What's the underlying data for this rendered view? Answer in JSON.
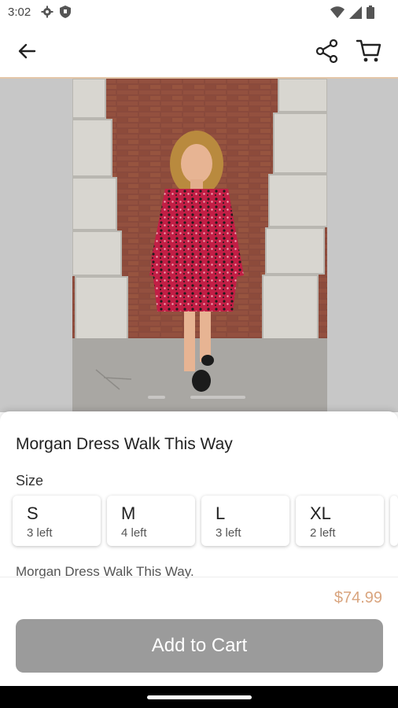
{
  "status_bar": {
    "time": "3:02",
    "left_icons": [
      "gear-icon",
      "shield-icon"
    ],
    "right_icons": [
      "wifi-icon",
      "signal-icon",
      "battery-icon"
    ]
  },
  "app_bar": {
    "icons": [
      "back-arrow-icon",
      "share-icon",
      "cart-icon"
    ]
  },
  "product": {
    "title": "Morgan Dress Walk This Way",
    "size_label": "Size",
    "sizes": [
      {
        "name": "S",
        "stock": "3 left"
      },
      {
        "name": "M",
        "stock": "4 left"
      },
      {
        "name": "L",
        "stock": "3 left"
      },
      {
        "name": "XL",
        "stock": "2 left"
      }
    ],
    "description": "Morgan Dress Walk This Way.",
    "price": "$74.99",
    "add_to_cart_label": "Add to Cart"
  },
  "colors": {
    "accent": "#d9a57f",
    "button_disabled": "#9b9b9b",
    "app_bar_border": "#e3c6a8"
  }
}
